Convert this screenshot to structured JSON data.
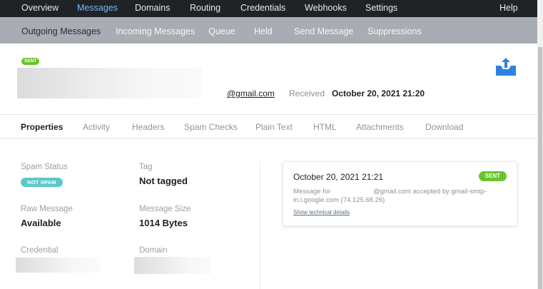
{
  "top_nav": {
    "items": [
      "Overview",
      "Messages",
      "Domains",
      "Routing",
      "Credentials",
      "Webhooks",
      "Settings"
    ],
    "active": "Messages",
    "help": "Help"
  },
  "sub_nav": {
    "items": [
      "Outgoing Messages",
      "Incoming Messages",
      "Queue",
      "Held",
      "Send Message",
      "Suppressions"
    ],
    "active": "Outgoing Messages"
  },
  "message": {
    "status_badge": "SENT",
    "recipient_suffix": "@gmail.com",
    "received_label": "Received",
    "received_date": "October 20, 2021 21:20"
  },
  "tabs": {
    "items": [
      "Properties",
      "Activity",
      "Headers",
      "Spam Checks",
      "Plain Text",
      "HTML",
      "Attachments",
      "Download"
    ],
    "active": "Properties"
  },
  "properties": {
    "spam_status_label": "Spam Status",
    "spam_status_badge": "NOT SPAM",
    "tag_label": "Tag",
    "tag_value": "Not tagged",
    "raw_message_label": "Raw Message",
    "raw_message_value": "Available",
    "message_size_label": "Message Size",
    "message_size_value": "1014 Bytes",
    "credential_label": "Credential",
    "domain_label": "Domain"
  },
  "delivery": {
    "date": "October 20, 2021 21:21",
    "badge": "SENT",
    "message_for": "Message for",
    "accepted_text": "@gmail.com accepted by gmail-smtp-",
    "server_line": "in.l.google.com (74.125.68.26)",
    "details_link": "Show technical details"
  },
  "colors": {
    "top_nav_bg": "#1f2326",
    "sub_nav_bg": "#a7adb3",
    "active_link": "#76b7ff",
    "sent_green": "#6ac42b",
    "not_spam_teal": "#5cc8c8",
    "upload_icon": "#2f80e0"
  },
  "icons": {
    "upload": "upload-tray-icon"
  }
}
